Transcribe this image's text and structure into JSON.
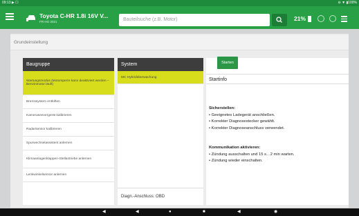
{
  "statusbar": {
    "left": "09:13 ▶ ☐",
    "right": "⊖ ▼ ▮100%"
  },
  "appbar": {
    "vehicle_title": "Toyota C-HR 1.8i 16V V...",
    "vehicle_sub": "FR-HG 2021",
    "search_placeholder": "Bauteilsuche (z.B. Motor)",
    "battery_percent": "21%",
    "icons": [
      "menu-icon",
      "car-icon",
      "search-icon",
      "battery-icon",
      "block-icon",
      "settings-icon",
      "more-icon"
    ]
  },
  "breadcrumb": "Grundeinstellung",
  "baugruppe": {
    "header": "Baugruppe",
    "items": [
      "Wartungsmodus (Motorsperre kann deaktiviert werden – Benzinmotor läuft)",
      "Bremssystem entlüften",
      "Kameraseevergerät kalibrieren",
      "Radarsensor kalibrieren",
      "Spurwechselassistent anlernen",
      "Klimaanlagenklappen-Stellantriebe anlernen",
      "Lenkwinkelsensor anlernen"
    ]
  },
  "system": {
    "header": "System",
    "items": [
      "MC Hybridüberwachung"
    ],
    "footer": "Diagn.-Anschluss: OBD"
  },
  "info": {
    "start_button": "Starten",
    "startinfo_title": "Startinfo",
    "section1_title": "Sicherstellen:",
    "section1_lines": [
      "• Geeignetes Ladegerät anschließen.",
      "• Korrekter Diagnosestecker gewählt.",
      "• Korrekter Diagnoseanschluss verwendet."
    ],
    "section2_title": "Kommunikation aktivieren:",
    "section2_lines": [
      "• Zündung ausschalten und 15 s…2 min warten.",
      "• Zündung wieder einschalten."
    ]
  },
  "colors": {
    "green": "#27a046",
    "dark_green": "#1b7d36",
    "lime": "#d7dd1b",
    "header_grey": "#3d3d3d"
  }
}
